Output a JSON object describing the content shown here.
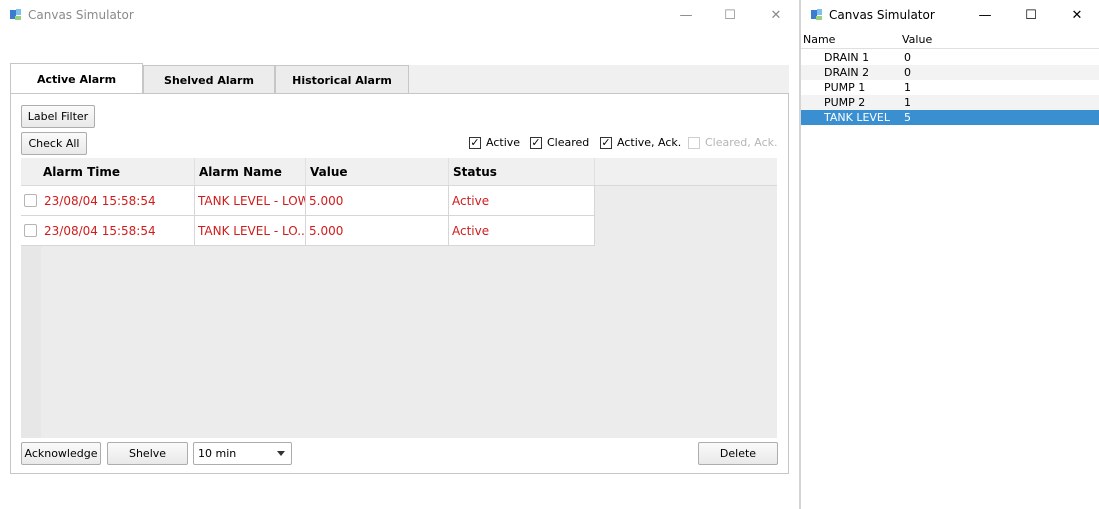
{
  "main_window": {
    "title": "Canvas Simulator",
    "controls": {
      "minimize": "—",
      "maximize": "☐",
      "close": "✕"
    },
    "tabs": [
      "Active Alarm",
      "Shelved Alarm",
      "Historical Alarm"
    ],
    "label_filter": "Label Filter",
    "check_all": "Check All",
    "filters": [
      {
        "label": "Active",
        "checked": true,
        "enabled": true
      },
      {
        "label": "Cleared",
        "checked": true,
        "enabled": true
      },
      {
        "label": "Active, Ack.",
        "checked": true,
        "enabled": true
      },
      {
        "label": "Cleared, Ack.",
        "checked": false,
        "enabled": false
      }
    ],
    "columns": [
      "Alarm Time",
      "Alarm Name",
      "Value",
      "Status"
    ],
    "rows": [
      {
        "time": "23/08/04 15:58:54",
        "name": "TANK LEVEL - LOW",
        "value": "5.000",
        "status": "Active"
      },
      {
        "time": "23/08/04 15:58:54",
        "name": "TANK LEVEL - LO...",
        "value": "5.000",
        "status": "Active"
      }
    ],
    "acknowledge": "Acknowledge",
    "shelve": "Shelve",
    "shelve_duration": "10 min",
    "delete": "Delete"
  },
  "side_window": {
    "title": "Canvas Simulator",
    "controls": {
      "minimize": "—",
      "maximize": "☐",
      "close": "✕"
    },
    "columns": [
      "Name",
      "Value"
    ],
    "rows": [
      {
        "name": "DRAIN 1",
        "value": "0"
      },
      {
        "name": "DRAIN 2",
        "value": "0"
      },
      {
        "name": "PUMP 1",
        "value": "1"
      },
      {
        "name": "PUMP 2",
        "value": "1"
      },
      {
        "name": "TANK LEVEL",
        "value": "5"
      }
    ],
    "selected": "TANK LEVEL"
  },
  "colors": {
    "alarm_text": "#d01c1c",
    "selection": "#3a8fd1"
  }
}
